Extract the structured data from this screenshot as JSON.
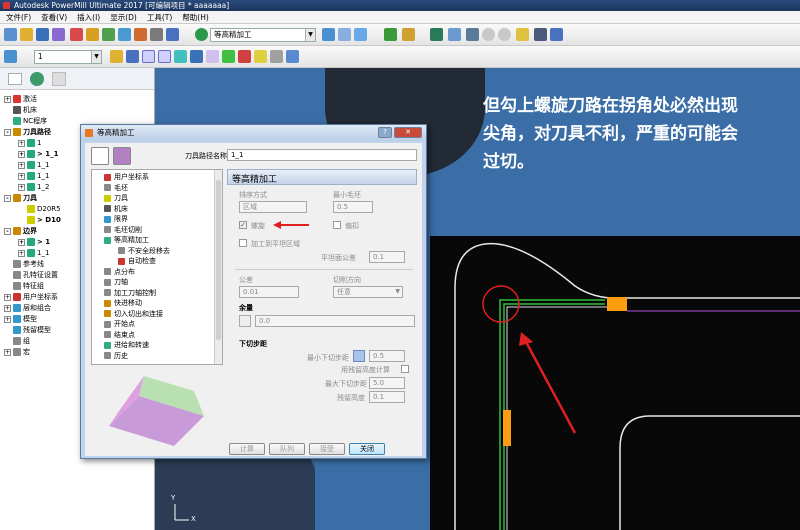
{
  "window": {
    "title": "Autodesk PowerMill Ultimate 2017  [可编辑项目 * aaaaaaa]"
  },
  "menu": [
    "文件(F)",
    "查看(V)",
    "插入(I)",
    "显示(D)",
    "工具(T)",
    "帮助(H)"
  ],
  "toolbar": {
    "layer_combo": "1",
    "strategy_combo": "等高精加工"
  },
  "explorer": {
    "items": [
      {
        "label": "激活",
        "depth": 0,
        "expander": "+",
        "bold": false,
        "color": "#d33"
      },
      {
        "label": "机床",
        "depth": 0,
        "expander": "",
        "bold": false,
        "color": "#555"
      },
      {
        "label": "NC程序",
        "depth": 0,
        "expander": "",
        "bold": false,
        "color": "#3a8"
      },
      {
        "label": "刀具路径",
        "depth": 0,
        "expander": "-",
        "bold": true,
        "color": "#c80"
      },
      {
        "label": "1",
        "depth": 1,
        "expander": "+",
        "bold": false,
        "color": "#2a7"
      },
      {
        "label": "> 1_1",
        "depth": 1,
        "expander": "+",
        "bold": true,
        "color": "#2a7"
      },
      {
        "label": "1_1",
        "depth": 1,
        "expander": "+",
        "bold": false,
        "color": "#2a7"
      },
      {
        "label": "1_1",
        "depth": 1,
        "expander": "+",
        "bold": false,
        "color": "#2a7"
      },
      {
        "label": "1_2",
        "depth": 1,
        "expander": "+",
        "bold": false,
        "color": "#2a7"
      },
      {
        "label": "刀具",
        "depth": 0,
        "expander": "-",
        "bold": true,
        "color": "#c80"
      },
      {
        "label": "D20R5",
        "depth": 1,
        "expander": "",
        "bold": false,
        "color": "#cc0"
      },
      {
        "label": "> D10",
        "depth": 1,
        "expander": "",
        "bold": true,
        "color": "#cc0"
      },
      {
        "label": "边界",
        "depth": 0,
        "expander": "-",
        "bold": true,
        "color": "#c80"
      },
      {
        "label": "> 1",
        "depth": 1,
        "expander": "+",
        "bold": true,
        "color": "#2a7"
      },
      {
        "label": "1_1",
        "depth": 1,
        "expander": "+",
        "bold": false,
        "color": "#2a7"
      },
      {
        "label": "参考线",
        "depth": 0,
        "expander": "",
        "bold": false,
        "color": "#888"
      },
      {
        "label": "孔特征设置",
        "depth": 0,
        "expander": "",
        "bold": false,
        "color": "#888"
      },
      {
        "label": "特征组",
        "depth": 0,
        "expander": "",
        "bold": false,
        "color": "#888"
      },
      {
        "label": "用户坐标系",
        "depth": 0,
        "expander": "+",
        "bold": false,
        "color": "#c33"
      },
      {
        "label": "层和组合",
        "depth": 0,
        "expander": "+",
        "bold": false,
        "color": "#39c"
      },
      {
        "label": "模型",
        "depth": 0,
        "expander": "+",
        "bold": false,
        "color": "#39c"
      },
      {
        "label": "残留模型",
        "depth": 0,
        "expander": "",
        "bold": false,
        "color": "#39c"
      },
      {
        "label": "组",
        "depth": 0,
        "expander": "",
        "bold": false,
        "color": "#888"
      },
      {
        "label": "宏",
        "depth": 0,
        "expander": "+",
        "bold": false,
        "color": "#888"
      }
    ]
  },
  "annotation": {
    "lines": [
      "但勾上螺旋刀路在拐角处必然出现",
      "尖角，对刀具不利，严重的可能会",
      "过切。"
    ],
    "color": "#ffffff"
  },
  "dialog": {
    "title": "等高精加工",
    "name_label": "刀具路径名称",
    "name_value": "1_1",
    "section_title": "等高精加工",
    "tree": [
      {
        "label": "用户坐标系",
        "depth": 0,
        "color": "#c33"
      },
      {
        "label": "毛坯",
        "depth": 0,
        "color": "#888"
      },
      {
        "label": "刀具",
        "depth": 0,
        "color": "#cc0"
      },
      {
        "label": "机床",
        "depth": 0,
        "color": "#555"
      },
      {
        "label": "限界",
        "depth": 0,
        "color": "#39c"
      },
      {
        "label": "毛坯切削",
        "depth": 0,
        "color": "#888"
      },
      {
        "label": "等高精加工",
        "depth": 0,
        "color": "#3a8"
      },
      {
        "label": "不安全段移去",
        "depth": 1,
        "color": "#888"
      },
      {
        "label": "自动检查",
        "depth": 1,
        "color": "#c33"
      },
      {
        "label": "点分布",
        "depth": 0,
        "color": "#888"
      },
      {
        "label": "刀轴",
        "depth": 0,
        "color": "#888"
      },
      {
        "label": "加工刀轴控制",
        "depth": 0,
        "color": "#888"
      },
      {
        "label": "快进移动",
        "depth": 0,
        "color": "#c80"
      },
      {
        "label": "切入切出和连接",
        "depth": 0,
        "color": "#c80"
      },
      {
        "label": "开始点",
        "depth": 0,
        "color": "#888"
      },
      {
        "label": "结束点",
        "depth": 0,
        "color": "#888"
      },
      {
        "label": "进给和转速",
        "depth": 0,
        "color": "#3a8"
      },
      {
        "label": "历史",
        "depth": 0,
        "color": "#888"
      }
    ],
    "sort_label": "排序方式",
    "sort_value": "区域",
    "min_stock_label": "最小毛坯",
    "min_stock_value": "0.5",
    "spiral_label": "螺旋",
    "spiral_checked": true,
    "follow_label": "偏扣",
    "flat_label": "加工到平坦区域",
    "flat_tol_label": "平坦面公差",
    "flat_tol_value": "0.1",
    "tolerance_label": "公差",
    "tolerance_value": "0.01",
    "direction_label": "切削方向",
    "direction_value": "任意",
    "allowance_label": "余量",
    "allowance_value": "0.0",
    "stepdown_label": "下切步距",
    "min_step_label": "最小下切步距",
    "min_step_value": "0.5",
    "scallop_label": "用残留高度计算",
    "max_step_label": "最大下切步距",
    "max_step_value": "5.0",
    "residual_label": "残留高度",
    "residual_value": "0.1",
    "buttons": {
      "calc": "计算",
      "queue": "队列",
      "accept": "接受",
      "close": "关闭"
    }
  }
}
